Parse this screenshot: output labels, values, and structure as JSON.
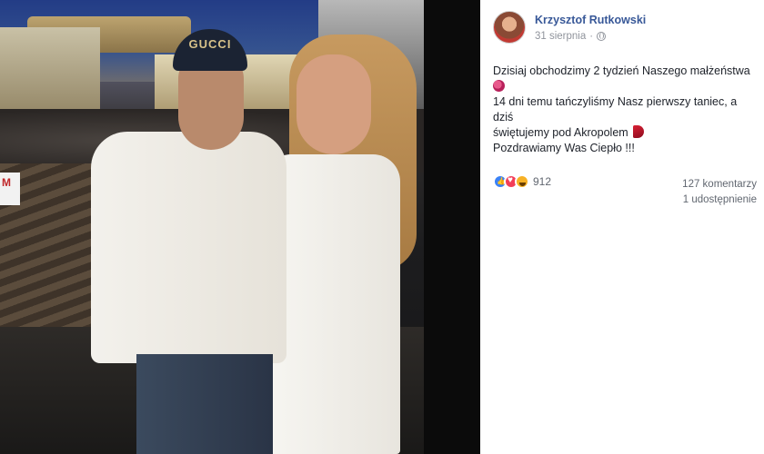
{
  "post": {
    "author": "Krzysztof Rutkowski",
    "date": "31 sierpnia",
    "separator": "·",
    "text_lines": [
      "Dzisiaj obchodzimy 2 tydzień Naszego małżeństwa",
      "14 dni temu tańczyliśmy Nasz pierwszy taniec, a dziś",
      "świętujemy pod Akropolem",
      "Pozdrawiamy Was Ciepło !!!"
    ],
    "reactions": {
      "count": "912",
      "types": [
        "like",
        "love",
        "haha"
      ]
    },
    "comments": "127 komentarzy",
    "shares": "1 udostępnienie"
  },
  "photo": {
    "cap_text": "GUCCI",
    "sign_text": "M"
  },
  "colors": {
    "author_link": "#385898",
    "meta_gray": "#90949c",
    "panel_bg": "#ffffff",
    "backdrop": "#0b0b0b"
  },
  "icons": {
    "audience": "globe-icon",
    "reactions": [
      "like-icon",
      "love-icon",
      "haha-icon"
    ]
  }
}
